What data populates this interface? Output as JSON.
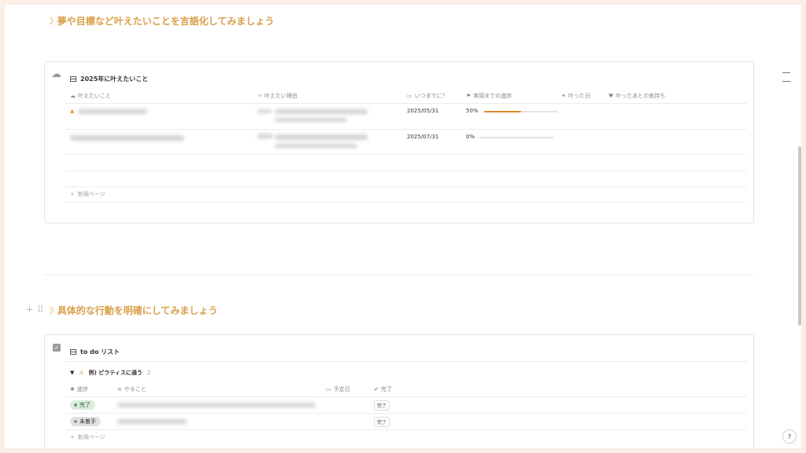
{
  "section1": {
    "heading": "夢や目標など叶えたいことを言語化してみましょう"
  },
  "db1": {
    "title": "2025年に叶えたいこと",
    "columns": [
      {
        "icon": "cloud-icon",
        "label": "叶えたいこと"
      },
      {
        "icon": "sparkle-icon",
        "label": "叶えたい理由"
      },
      {
        "icon": "calendar-icon",
        "label": "いつまでに？"
      },
      {
        "icon": "flag-icon",
        "label": "実現までの進捗"
      },
      {
        "icon": "party-icon",
        "label": "叶った日"
      },
      {
        "icon": "heart-icon",
        "label": "叶ったあとの気持ち"
      }
    ],
    "rows": [
      {
        "date": "2025/05/31",
        "progress_label": "50%",
        "progress": 0.5
      },
      {
        "date": "2025/07/31",
        "progress_label": "0%",
        "progress": 0.0
      }
    ],
    "new_page": "新規ページ"
  },
  "section2": {
    "heading": "具体的な行動を明確にしてみましょう"
  },
  "db2": {
    "title": "to do リスト",
    "group": {
      "label": "例) ピラティスに通う",
      "count": "2"
    },
    "columns": [
      {
        "icon": "progress-icon",
        "label": "進捗"
      },
      {
        "icon": "list-icon",
        "label": "やること"
      },
      {
        "icon": "calendar-icon",
        "label": "予定日"
      },
      {
        "icon": "check-circle-icon",
        "label": "完了"
      }
    ],
    "rows": [
      {
        "status": "完了",
        "status_color": "#dbeddb",
        "dot_color": "#6c9b7d",
        "done_button": "完了"
      },
      {
        "status": "未着手",
        "status_color": "#e3e2e0",
        "dot_color": "#91918e",
        "done_button": "完了"
      }
    ],
    "new_page": "新規ページ"
  },
  "help": "?",
  "colors": {
    "heading": "#d9a04a",
    "progress": "#e08a2b"
  }
}
